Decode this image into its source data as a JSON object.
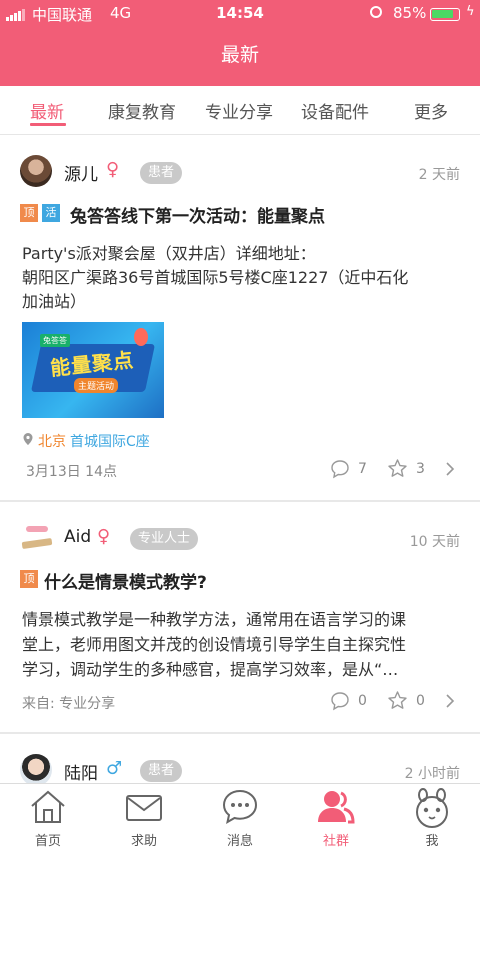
{
  "status_bar": {
    "carrier": "中国联通",
    "network": "4G",
    "time": "14:54",
    "battery": "85%",
    "battery_level": 0.85
  },
  "header": {
    "title": "最新"
  },
  "tabs": [
    {
      "label": "最新",
      "active": true
    },
    {
      "label": "康复教育"
    },
    {
      "label": "专业分享"
    },
    {
      "label": "设备配件"
    },
    {
      "label": "更多"
    }
  ],
  "posts": [
    {
      "author": "源儿",
      "gender": "♀",
      "badge": "患者",
      "time_ago": "2 天前",
      "tags": [
        "顶",
        "活"
      ],
      "title": "兔答答线下第一次活动：能量聚点",
      "body_line1": "Party's派对聚会屋（双井店）详细地址：",
      "body_line2": "朝阳区广渠路36号首城国际5号楼C座1227（近中石化",
      "body_line3": "加油站）",
      "image_text": {
        "badge": "兔答答",
        "main": "能量聚点",
        "sub": "主题活动"
      },
      "location_city": "北京",
      "location_place": "首城国际C座",
      "date": "3月13日 14点",
      "comments": "7",
      "stars": "3"
    },
    {
      "author": "Aid",
      "gender": "♀",
      "badge": "专业人士",
      "time_ago": "10 天前",
      "tags": [
        "顶"
      ],
      "title": "什么是情景模式教学?",
      "body_line1": "情景模式教学是一种教学方法，通常用在语言学习的课",
      "body_line2": "堂上，老师用图文并茂的创设情境引导学生自主探究性",
      "body_line3": "学习，调动学生的多种感官，提高学习效率，是从“…",
      "source": "来自: 专业分享",
      "comments": "0",
      "stars": "0"
    },
    {
      "author": "陆阳",
      "gender": "♂",
      "badge": "患者",
      "time_ago": "2 小时前"
    }
  ],
  "tabbar": [
    {
      "label": "首页",
      "icon": "home-icon"
    },
    {
      "label": "求助",
      "icon": "envelope-icon"
    },
    {
      "label": "消息",
      "icon": "chat-bubble-icon"
    },
    {
      "label": "社群",
      "icon": "community-icon",
      "active": true
    },
    {
      "label": "我",
      "icon": "bunny-face-icon"
    }
  ],
  "colors": {
    "accent": "#f25d77",
    "tag_top": "#f08a4b",
    "tag_event": "#3fa7e0",
    "female": "#f25d77",
    "male": "#3fa7e0",
    "location": "#f0852d",
    "location_link": "#3fa7e0"
  }
}
